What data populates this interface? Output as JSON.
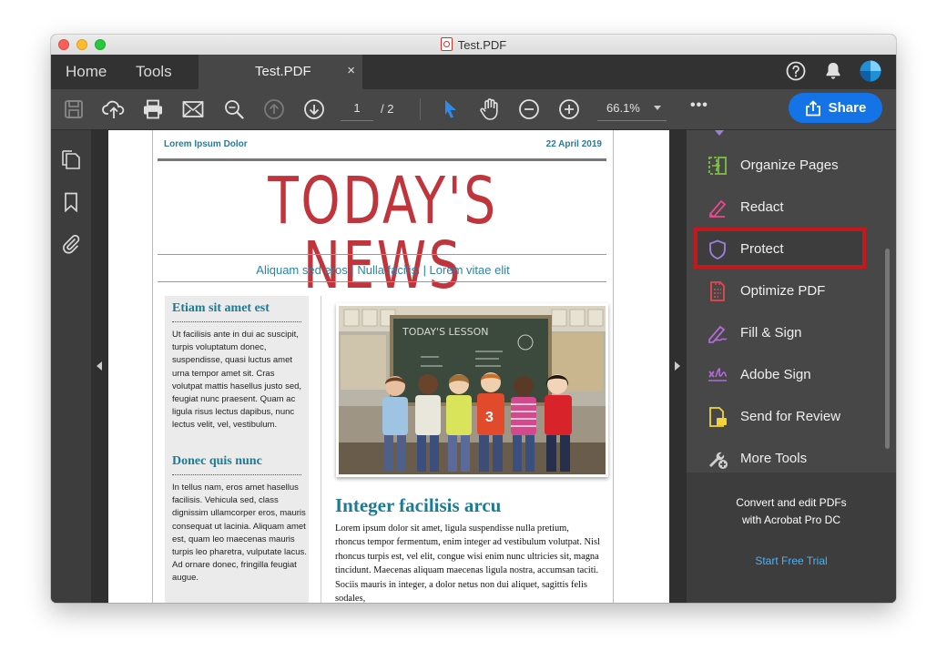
{
  "window": {
    "title": "Test.PDF"
  },
  "tabs": {
    "home": "Home",
    "tools": "Tools",
    "document": "Test.PDF",
    "close": "×"
  },
  "toolbar": {
    "current_page": "1",
    "page_total": "/ 2",
    "zoom": "66.1%",
    "more": "•••",
    "share_label": "Share"
  },
  "document": {
    "header_left": "Lorem Ipsum Dolor",
    "header_right": "22 April 2019",
    "masthead": "TODAY'S NEWS",
    "subline": "Aliquam sed eros | Nulla facilisi | Lorem vitae elit",
    "sidebar": {
      "head1": "Etiam sit amet est",
      "body1": "Ut facilisis ante in dui ac suscipit, turpis voluptatum donec, suspendisse, quasi luctus amet urna tempor amet sit. Cras volutpat mattis hasellus justo sed, feugiat nunc praesent. Quam ac ligula risus lectus dapibus, nunc lectus velit, vel, vestibulum.",
      "head2": "Donec quis nunc",
      "body2": "In tellus nam, eros amet hasellus facilisis. Vehicula sed, class dignissim ullamcorper eros, mauris consequat ut lacinia. Aliquam amet est, quam leo maecenas mauris turpis leo pharetra, vulputate lacus. Ad ornare donec, fringilla feugiat augue."
    },
    "chalkboard_text": "TODAY'S LESSON",
    "article_title": "Integer facilisis arcu",
    "article_body": "Lorem ipsum dolor sit amet, ligula suspendisse nulla pretium, rhoncus tempor fermentum, enim integer ad vestibulum volutpat. Nisl rhoncus turpis est, vel elit, congue wisi enim nunc ultricies sit, magna tincidunt. Maecenas aliquam maecenas ligula nostra, accumsan taciti. Sociis mauris in integer, a dolor netus non dui aliquet, sagittis felis sodales,"
  },
  "tools_pane": {
    "items": [
      {
        "label": "Organize Pages",
        "icon": "organize-pages-icon",
        "color": "#7cc142"
      },
      {
        "label": "Redact",
        "icon": "redact-icon",
        "color": "#e8498e"
      },
      {
        "label": "Protect",
        "icon": "protect-shield-icon",
        "color": "#9b7fd8"
      },
      {
        "label": "Optimize PDF",
        "icon": "optimize-pdf-icon",
        "color": "#e34850"
      },
      {
        "label": "Fill & Sign",
        "icon": "fill-sign-icon",
        "color": "#b26bd8"
      },
      {
        "label": "Adobe Sign",
        "icon": "adobe-sign-icon",
        "color": "#b26bd8"
      },
      {
        "label": "Send for Review",
        "icon": "send-review-icon",
        "color": "#f2d33a"
      },
      {
        "label": "More Tools",
        "icon": "more-tools-icon",
        "color": "#d0d0d0"
      }
    ],
    "promo_line1": "Convert and edit PDFs",
    "promo_line2": "with Acrobat Pro DC",
    "promo_link": "Start Free Trial"
  },
  "colors": {
    "accent": "#1473e6",
    "highlight_border": "#c8161d",
    "masthead": "#c0343c",
    "heading_teal": "#1d7a94"
  }
}
